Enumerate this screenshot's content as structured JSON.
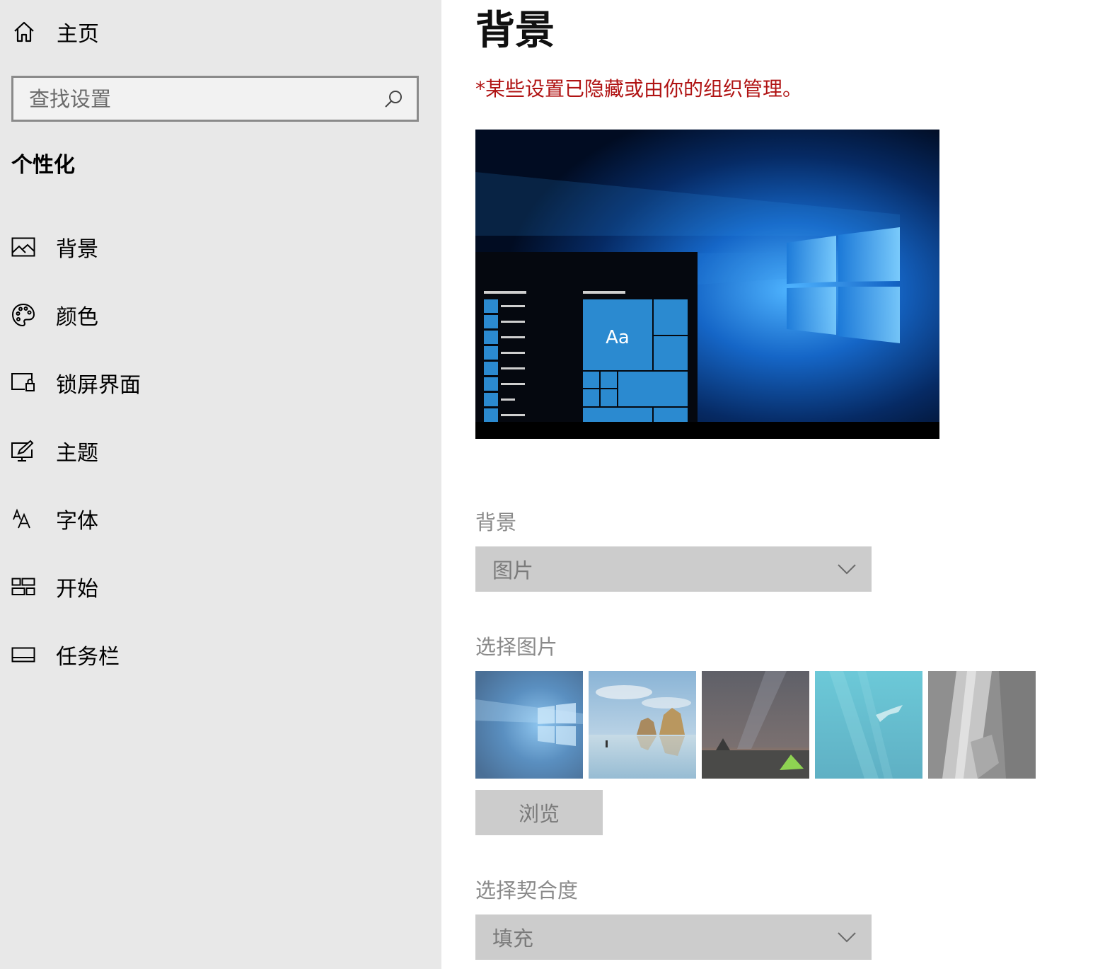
{
  "sidebar": {
    "home_label": "主页",
    "search_placeholder": "查找设置",
    "section_title": "个性化",
    "items": [
      {
        "label": "背景",
        "icon": "picture-icon"
      },
      {
        "label": "颜色",
        "icon": "palette-icon"
      },
      {
        "label": "锁屏界面",
        "icon": "lock-screen-icon"
      },
      {
        "label": "主题",
        "icon": "theme-icon"
      },
      {
        "label": "字体",
        "icon": "font-icon"
      },
      {
        "label": "开始",
        "icon": "start-icon"
      },
      {
        "label": "任务栏",
        "icon": "taskbar-icon"
      }
    ]
  },
  "main": {
    "title": "背景",
    "notice": "*某些设置已隐藏或由你的组织管理。",
    "preview": {
      "tile_text": "Aa"
    },
    "background": {
      "label": "背景",
      "value": "图片"
    },
    "choose_picture": {
      "label": "选择图片",
      "thumbnails": [
        "windows-hero",
        "beach-rocks",
        "night-sky-tent",
        "underwater-swimmer",
        "rock-cliff"
      ]
    },
    "browse_label": "浏览",
    "fit": {
      "label": "选择契合度",
      "value": "填充"
    }
  },
  "colors": {
    "sidebar_bg": "#e8e8e8",
    "notice_red": "#b01313",
    "dropdown_bg": "#cccccc",
    "disabled_text": "#8a8a8a",
    "tile_blue": "#2b8ad0"
  }
}
